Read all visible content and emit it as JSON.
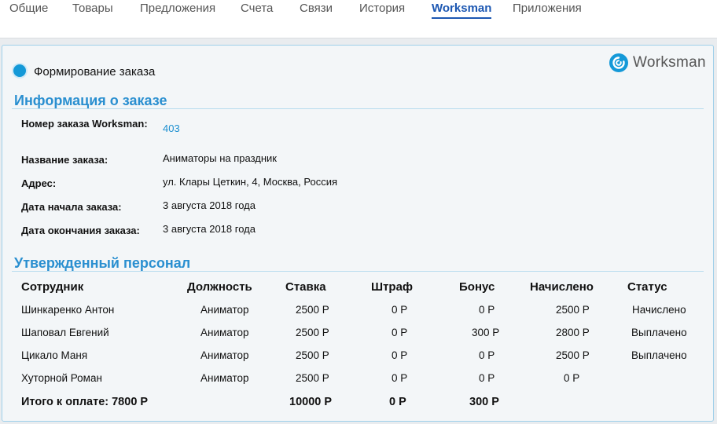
{
  "tabs": [
    {
      "label": "Общие",
      "active": false
    },
    {
      "label": "Товары",
      "active": false
    },
    {
      "label": "Предложения",
      "active": false
    },
    {
      "label": "Счета",
      "active": false
    },
    {
      "label": "Связи",
      "active": false
    },
    {
      "label": "История",
      "active": false
    },
    {
      "label": "Worksman",
      "active": true
    },
    {
      "label": "Приложения",
      "active": false
    }
  ],
  "form_label": "Формирование заказа",
  "logo": {
    "text": "Worksman",
    "icon": "worksman-logo-icon",
    "color": "#1499d8"
  },
  "order_section": {
    "title": "Информация о заказе",
    "fields": [
      {
        "label": "Номер заказа Worksman:",
        "value": "403"
      },
      {
        "label": "Название заказа:",
        "value": "Аниматоры на праздник"
      },
      {
        "label": "Адрес:",
        "value": "ул. Клары Цеткин, 4, Москва, Россия"
      },
      {
        "label": "Дата начала заказа:",
        "value": "3 августа 2018 года"
      },
      {
        "label": "Дата окончания заказа:",
        "value": "3 августа 2018 года"
      }
    ]
  },
  "staff_section": {
    "title": "Утвержденный персонал",
    "columns": [
      "Сотрудник",
      "Должность",
      "Ставка",
      "Штраф",
      "Бонус",
      "Начислено",
      "Статус"
    ],
    "rows": [
      [
        "Шинкаренко Антон",
        "Аниматор",
        "2500 Р",
        "0 Р",
        "0 Р",
        "2500 Р",
        "Начислено"
      ],
      [
        "Шаповал Евгений",
        "Аниматор",
        "2500 Р",
        "0 Р",
        "300 Р",
        "2800 Р",
        "Выплачено"
      ],
      [
        "Цикало Маня",
        "Аниматор",
        "2500 Р",
        "0 Р",
        "0 Р",
        "2500 Р",
        "Выплачено"
      ],
      [
        "Хуторной Роман",
        "Аниматор",
        "2500 Р",
        "0 Р",
        "0 Р",
        "0 Р",
        ""
      ]
    ],
    "totals": {
      "label": "Итого к оплате: 7800 Р",
      "rate": "10000 Р",
      "penalty": "0 Р",
      "bonus": "300 Р"
    }
  },
  "colors": {
    "accent": "#2a8fd0",
    "active_tab": "#1c57b2",
    "link": "#1c8fd0"
  }
}
